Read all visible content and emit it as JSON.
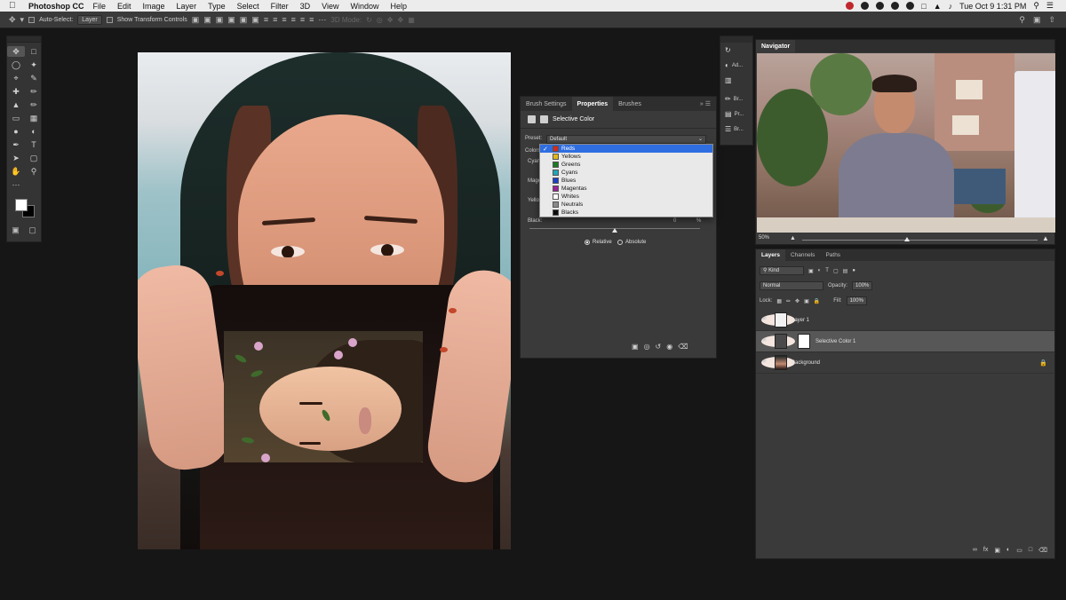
{
  "menubar": {
    "app_name": "Photoshop CC",
    "menus": [
      "File",
      "Edit",
      "Image",
      "Layer",
      "Type",
      "Select",
      "Filter",
      "3D",
      "View",
      "Window",
      "Help"
    ],
    "clock": "Tue Oct 9  1:31 PM"
  },
  "options_bar": {
    "auto_select_label": "Auto-Select:",
    "auto_select_value": "Layer",
    "show_transform_label": "Show Transform Controls",
    "mode_3d_label": "3D Mode:"
  },
  "properties_panel": {
    "tabs": [
      "Brush Settings",
      "Properties",
      "Brushes"
    ],
    "title": "Selective Color",
    "preset_label": "Preset:",
    "preset_value": "Default",
    "colors_label": "Colors:",
    "sliders": [
      {
        "label": "Cyan:",
        "value": ""
      },
      {
        "label": "Magenta:",
        "value": ""
      },
      {
        "label": "Yellow:",
        "value": ""
      },
      {
        "label": "Black:",
        "value": "0",
        "unit": "%"
      }
    ],
    "method_relative": "Relative",
    "method_absolute": "Absolute"
  },
  "colors_dropdown": {
    "options": [
      {
        "label": "Reds",
        "swatch": "#d42a1c",
        "selected": true
      },
      {
        "label": "Yellows",
        "swatch": "#e0b81a"
      },
      {
        "label": "Greens",
        "swatch": "#1d7a25"
      },
      {
        "label": "Cyans",
        "swatch": "#20a7b8"
      },
      {
        "label": "Blues",
        "swatch": "#1c3fc7"
      },
      {
        "label": "Magentas",
        "swatch": "#9a2296"
      },
      {
        "label": "Whites",
        "swatch": "#ffffff"
      },
      {
        "label": "Neutrals",
        "swatch": "#8a8a8a"
      },
      {
        "label": "Blacks",
        "swatch": "#0e0e0e"
      }
    ]
  },
  "dock": {
    "items": [
      "Ad...",
      "Br...",
      "Pr...",
      "Br..."
    ]
  },
  "navigator": {
    "tab": "Navigator",
    "zoom": "50%"
  },
  "layers_panel": {
    "tabs": [
      "Layers",
      "Channels",
      "Paths"
    ],
    "filter_label": "Kind",
    "blend_mode": "Normal",
    "opacity_label": "Opacity:",
    "opacity_value": "100%",
    "lock_label": "Lock:",
    "fill_label": "Fill:",
    "fill_value": "100%",
    "layers": [
      {
        "name": "Layer 1",
        "selected": false
      },
      {
        "name": "Selective Color 1",
        "selected": true
      },
      {
        "name": "Background",
        "selected": false,
        "locked": true
      }
    ],
    "footer_fx": "fx"
  }
}
